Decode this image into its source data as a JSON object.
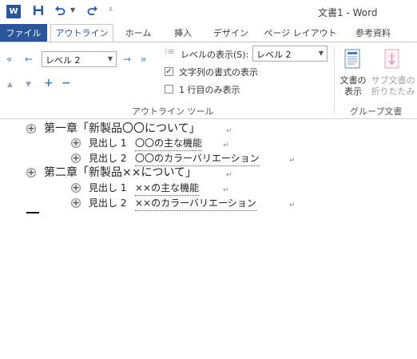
{
  "titlebar": {
    "logo_letter": "W",
    "title": "文書1 - Word",
    "save_icon": "save-icon",
    "undo_icon": "undo-icon",
    "redo_icon": "redo-icon"
  },
  "tabs": [
    {
      "label": "ファイル"
    },
    {
      "label": "アウトライン"
    },
    {
      "label": "ホーム"
    },
    {
      "label": "挿入"
    },
    {
      "label": "デザイン"
    },
    {
      "label": "ページ レイアウト"
    },
    {
      "label": "参考資料"
    }
  ],
  "ribbon": {
    "level_select_value": "レベル 2",
    "show_level_label": "レベルの表示(S):",
    "show_level_value": "レベル 2",
    "show_text_formatting_label": "文字列の書式の表示",
    "show_text_formatting_checked": true,
    "show_first_line_only_label": "1 行目のみ表示",
    "show_first_line_only_checked": false,
    "outline_tools_caption": "アウトライン ツール",
    "show_document_label_line1": "文書の",
    "show_document_label_line2": "表示",
    "collapse_subdocs_label_line1": "サブ文書の",
    "collapse_subdocs_label_line2": "折りたたみ",
    "master_document_caption": "グループ文書"
  },
  "document": {
    "lines": [
      {
        "text": "第一章「新製品〇〇について」",
        "level": 1
      },
      {
        "prefix": "見出し 1 ",
        "text": "〇〇の主な機能",
        "level": 2
      },
      {
        "prefix": "見出し 2 ",
        "text": "〇〇のカラーバリエーション",
        "level": 2
      },
      {
        "text": "第二章「新製品××について」",
        "level": 1
      },
      {
        "prefix": "見出し 1 ",
        "text": "××の主な機能",
        "level": 2
      },
      {
        "prefix": "見出し 2 ",
        "text": "××のカラーバリエーション",
        "level": 2
      }
    ],
    "paragraph_mark": "↵",
    "plus_symbol": "+"
  }
}
